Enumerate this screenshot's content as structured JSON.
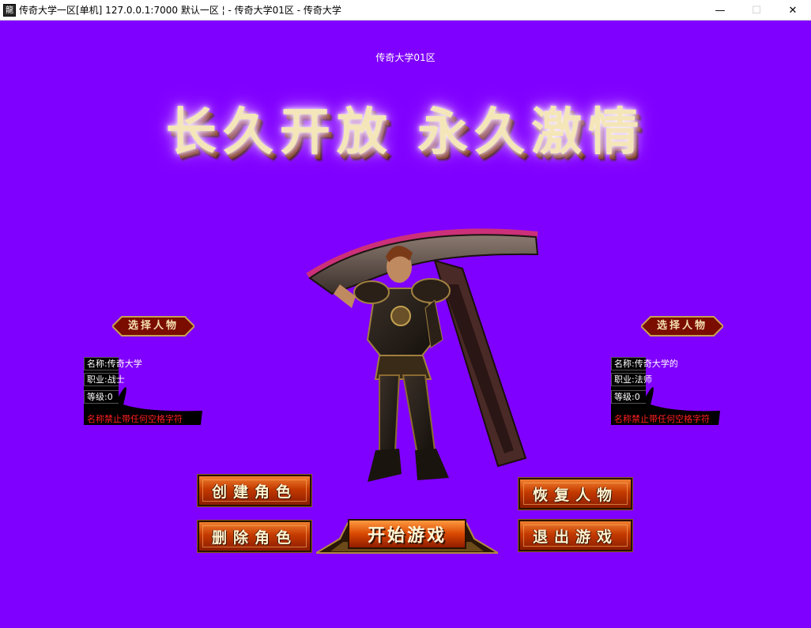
{
  "window": {
    "icon_text": "龍",
    "title": "传奇大学一区[单机] 127.0.0.1:7000  默认一区 ¦ - 传奇大学01区 - 传奇大学",
    "minimize_glyph": "—",
    "maximize_glyph": "☐",
    "close_glyph": "✕"
  },
  "server_name": "传奇大学01区",
  "slogan": "长久开放 永久激情",
  "left_panel": {
    "banner": "选择人物",
    "name_label": "名称:",
    "name": "传奇大学",
    "class_label": "职业:",
    "class": "战士",
    "level_label": "等级:",
    "level": "0",
    "warning": "名称禁止带任何空格字符"
  },
  "right_panel": {
    "banner": "选择人物",
    "name_label": "名称:",
    "name": "传奇大学的",
    "class_label": "职业:",
    "class": "法师",
    "level_label": "等级:",
    "level": "0",
    "warning": "名称禁止带任何空格字符"
  },
  "buttons": {
    "create": "创建角色",
    "delete": "删除角色",
    "restore": "恢复人物",
    "exit": "退出游戏",
    "start": "开始游戏"
  },
  "colors": {
    "background": "#8000ff",
    "warning": "#ff2020",
    "button_top": "#f08030",
    "button_bottom": "#8a1c00"
  }
}
